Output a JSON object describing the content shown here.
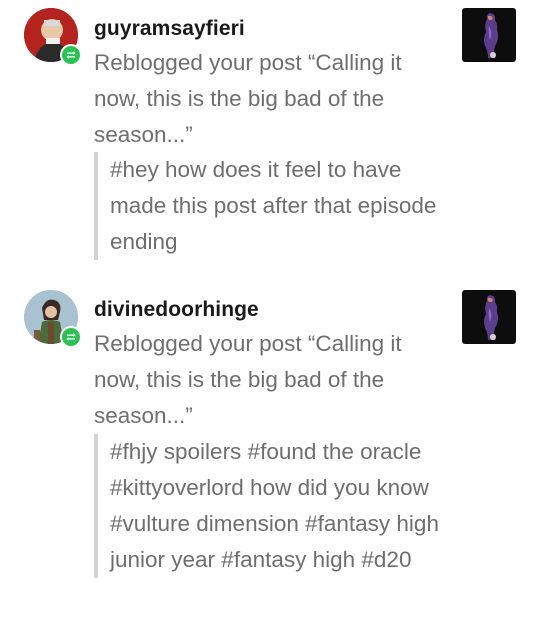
{
  "notifications": [
    {
      "username": "guyramsayfieri",
      "message": "Reblogged your post “Calling it now, this is the big bad of the season...”",
      "tags": "#hey how does it feel to have made this post after that episode ending",
      "avatar_icon": "user-avatar-icon",
      "badge_icon": "reblog-icon",
      "badge_color": "#2bc253",
      "thumbnail_icon": "post-thumbnail-image"
    },
    {
      "username": "divinedoorhinge",
      "message": "Reblogged your post “Calling it now, this is the big bad of the season...”",
      "tags": "#fhjy spoilers #found the oracle #kittyoverlord how did you know #vulture dimension #fantasy high junior year #fantasy high #d20",
      "avatar_icon": "user-avatar-icon",
      "badge_icon": "reblog-icon",
      "badge_color": "#2bc253",
      "thumbnail_icon": "post-thumbnail-image"
    }
  ]
}
